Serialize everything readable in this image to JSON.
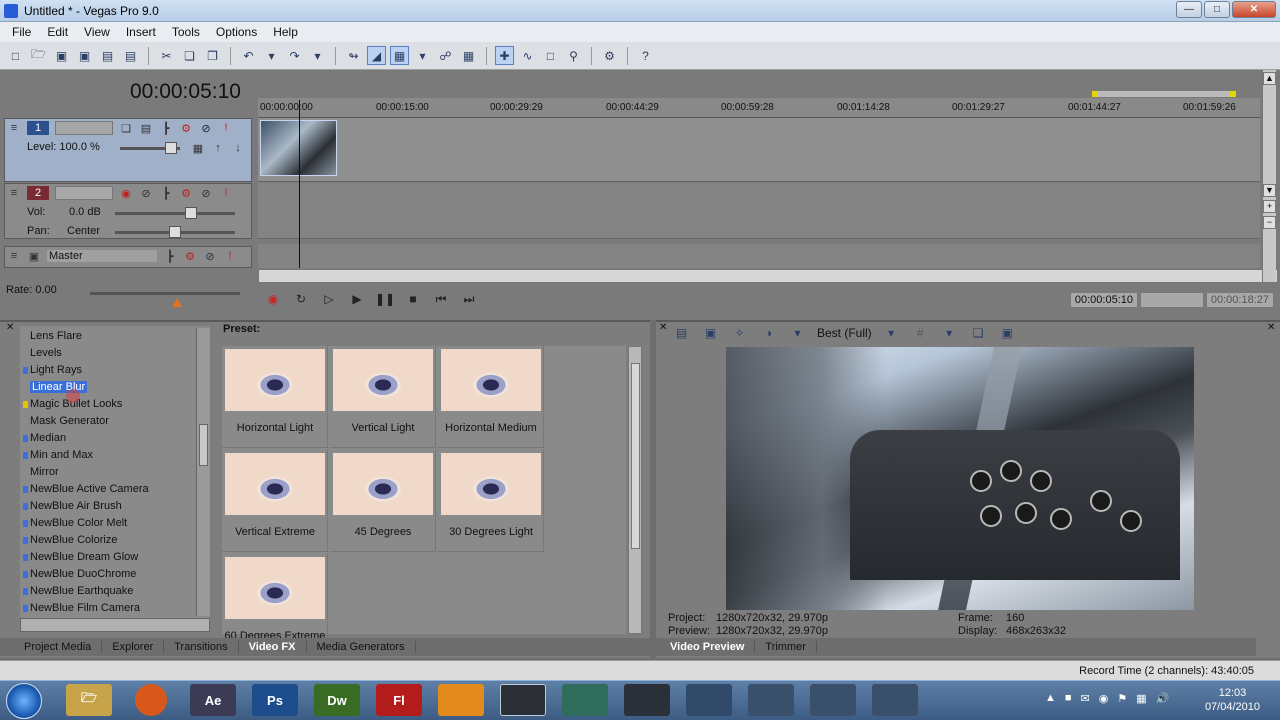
{
  "window": {
    "title": "Untitled * - Vegas Pro 9.0"
  },
  "menu": [
    "File",
    "Edit",
    "View",
    "Insert",
    "Tools",
    "Options",
    "Help"
  ],
  "timeline": {
    "timecode": "00:00:05:10",
    "ruler_ticks": [
      "00:00:00:00",
      "00:00:15:00",
      "00:00:29:29",
      "00:00:44:29",
      "00:00:59:28",
      "00:01:14:28",
      "00:01:29:27",
      "00:01:44:27",
      "00:01:59:26"
    ],
    "tracks": [
      {
        "number": "1",
        "level_label": "Level: 100.0 %"
      },
      {
        "number": "2",
        "vol_label": "Vol:",
        "vol_value": "0.0 dB",
        "pan_label": "Pan:",
        "pan_value": "Center"
      },
      {
        "name": "Master"
      }
    ],
    "rate": "Rate: 0.00",
    "transport": {
      "current": "00:00:05:10",
      "length": "00:00:18:27"
    }
  },
  "fx_list": {
    "items": [
      {
        "label": "Lens Flare",
        "marked": false,
        "selected": false
      },
      {
        "label": "Levels",
        "marked": false,
        "selected": false
      },
      {
        "label": "Light Rays",
        "marked": true,
        "selected": false
      },
      {
        "label": "Linear Blur",
        "marked": false,
        "selected": true
      },
      {
        "label": "Magic Bullet Looks",
        "marked": true,
        "selected": false,
        "mark_color": "#e6c200"
      },
      {
        "label": "Mask Generator",
        "marked": false,
        "selected": false
      },
      {
        "label": "Median",
        "marked": true,
        "selected": false
      },
      {
        "label": "Min and Max",
        "marked": true,
        "selected": false
      },
      {
        "label": "Mirror",
        "marked": false,
        "selected": false
      },
      {
        "label": "NewBlue Active Camera",
        "marked": true,
        "selected": false
      },
      {
        "label": "NewBlue Air Brush",
        "marked": true,
        "selected": false
      },
      {
        "label": "NewBlue Color Melt",
        "marked": true,
        "selected": false
      },
      {
        "label": "NewBlue Colorize",
        "marked": true,
        "selected": false
      },
      {
        "label": "NewBlue Dream Glow",
        "marked": true,
        "selected": false
      },
      {
        "label": "NewBlue DuoChrome",
        "marked": true,
        "selected": false
      },
      {
        "label": "NewBlue Earthquake",
        "marked": true,
        "selected": false
      },
      {
        "label": "NewBlue Film Camera",
        "marked": true,
        "selected": false
      }
    ]
  },
  "presets": {
    "label": "Preset:",
    "items": [
      "Horizontal Light",
      "Vertical Light",
      "Horizontal Medium",
      "Vertical Extreme",
      "45 Degrees",
      "30 Degrees Light",
      "60 Degrees Extreme"
    ]
  },
  "fx_tabs": [
    "Project Media",
    "Explorer",
    "Transitions",
    "Video FX",
    "Media Generators"
  ],
  "fx_active_tab": "Video FX",
  "preview": {
    "quality": "Best (Full)",
    "project_label": "Project:",
    "project_value": "1280x720x32, 29.970p",
    "preview_label": "Preview:",
    "preview_value": "1280x720x32, 29.970p",
    "frame_label": "Frame:",
    "frame_value": "160",
    "display_label": "Display:",
    "display_value": "468x263x32"
  },
  "preview_tabs": [
    "Video Preview",
    "Trimmer"
  ],
  "preview_active_tab": "Video Preview",
  "status": {
    "record_time": "Record Time (2 channels): 43:40:05"
  },
  "taskbar": {
    "apps": [
      "Ae",
      "Ps",
      "Dw",
      "Fl"
    ],
    "time": "12:03",
    "date": "07/04/2010"
  },
  "colors": {
    "accent": "#3a6fd8",
    "track2": "#7a2a33",
    "track1": "#2c4f8f"
  }
}
